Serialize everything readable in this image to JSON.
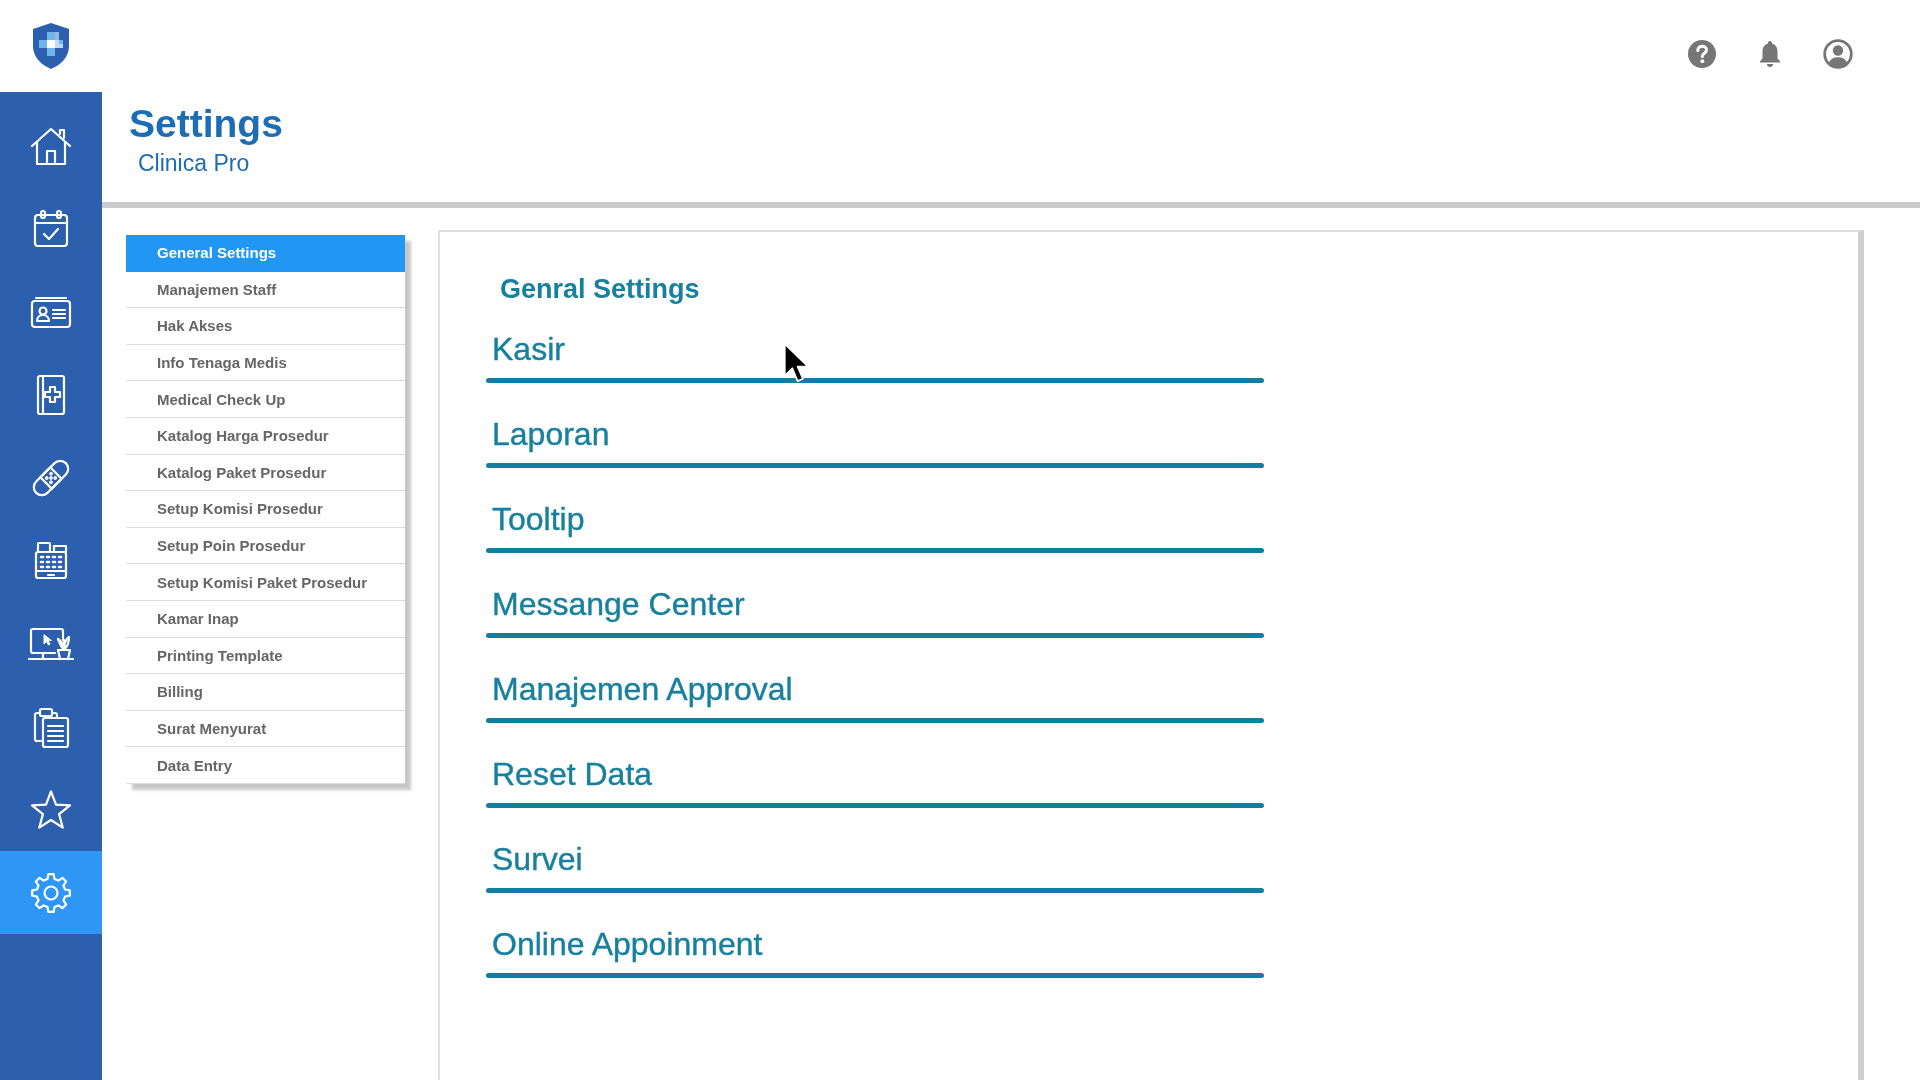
{
  "header": {
    "title": "Settings",
    "subtitle": "Clinica Pro"
  },
  "sidebar": {
    "items": [
      {
        "selected": false
      },
      {
        "selected": false
      },
      {
        "selected": false
      },
      {
        "selected": false
      },
      {
        "selected": false
      },
      {
        "selected": false
      },
      {
        "selected": false
      },
      {
        "selected": false
      },
      {
        "selected": false
      },
      {
        "selected": true
      }
    ]
  },
  "settings_menu": [
    {
      "label": "General Settings",
      "selected": true
    },
    {
      "label": "Manajemen Staff",
      "selected": false
    },
    {
      "label": "Hak Akses",
      "selected": false
    },
    {
      "label": "Info Tenaga Medis",
      "selected": false
    },
    {
      "label": "Medical Check Up",
      "selected": false
    },
    {
      "label": "Katalog Harga Prosedur",
      "selected": false
    },
    {
      "label": "Katalog Paket Prosedur",
      "selected": false
    },
    {
      "label": "Setup Komisi Prosedur",
      "selected": false
    },
    {
      "label": "Setup Poin Prosedur",
      "selected": false
    },
    {
      "label": "Setup Komisi Paket Prosedur",
      "selected": false
    },
    {
      "label": "Kamar Inap",
      "selected": false
    },
    {
      "label": "Printing Template",
      "selected": false
    },
    {
      "label": "Billing",
      "selected": false
    },
    {
      "label": "Surat Menyurat",
      "selected": false
    },
    {
      "label": "Data Entry",
      "selected": false
    }
  ],
  "panel": {
    "title": "Genral Settings",
    "sections": [
      "Kasir",
      "Laporan",
      "Tooltip",
      "Messange Center",
      "Manajemen Approval",
      "Reset Data",
      "Survei",
      "Online Appoinment"
    ]
  }
}
